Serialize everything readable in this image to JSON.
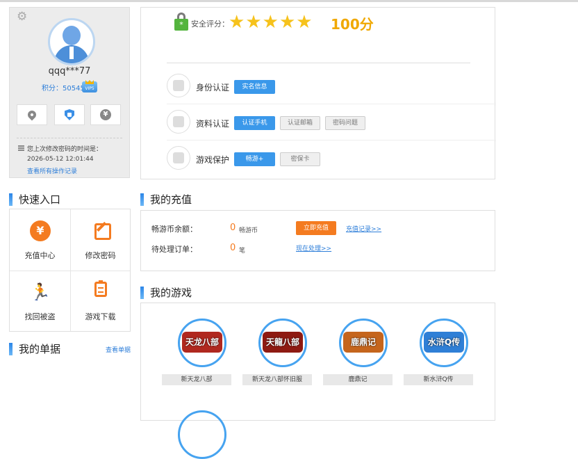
{
  "profile": {
    "username": "qqq***77",
    "points_label": "积分：50545",
    "vip": "VIP5",
    "password_changed_label": "您上次修改密码的时间是：",
    "password_changed_time": "2026-05-12 12:01:44",
    "view_logs_link": "查看所有操作记录"
  },
  "security": {
    "label": "安全评分：",
    "stars": 5,
    "score": "100分",
    "rows": [
      {
        "label": "身份认证",
        "buttons": [
          {
            "text": "实名信息",
            "style": "blue"
          }
        ]
      },
      {
        "label": "资料认证",
        "buttons": [
          {
            "text": "认证手机",
            "style": "blue"
          },
          {
            "text": "认证邮箱",
            "style": "gray"
          },
          {
            "text": "密码问题",
            "style": "gray"
          }
        ]
      },
      {
        "label": "游戏保护",
        "buttons": [
          {
            "text": "畅游+",
            "style": "blue"
          },
          {
            "text": "密保卡",
            "style": "gray"
          }
        ]
      }
    ]
  },
  "quick_entry": {
    "title": "快速入口",
    "items": [
      {
        "label": "充值中心",
        "icon": "yen-circle-icon"
      },
      {
        "label": "修改密码",
        "icon": "edit-icon"
      },
      {
        "label": "找回被盗",
        "icon": "runner-icon"
      },
      {
        "label": "游戏下载",
        "icon": "clipboard-icon"
      }
    ]
  },
  "orders": {
    "title": "我的单据",
    "view_link": "查看单据"
  },
  "recharge": {
    "title": "我的充值",
    "balance_label": "畅游币余额：",
    "balance_value": "0",
    "balance_unit": "畅游币",
    "recharge_button": "立即充值",
    "records_link": "充值记录>>",
    "pending_label": "待处理订单：",
    "pending_value": "0",
    "pending_unit": "笔",
    "process_link": "现在处理>>"
  },
  "games": {
    "title": "我的游戏",
    "items": [
      {
        "name": "新天龙八部",
        "logo": "天龙八部",
        "color": "#b0281f"
      },
      {
        "name": "新天龙八部怀旧服",
        "logo": "天龍八部",
        "color": "#8e1a12"
      },
      {
        "name": "鹿鼎记",
        "logo": "鹿鼎记",
        "color": "#c5651d"
      },
      {
        "name": "新水浒Q传",
        "logo": "水浒Q传",
        "color": "#2f7fd6"
      }
    ]
  },
  "colors": {
    "accent_blue": "#3a98ea",
    "accent_orange": "#f47b20",
    "star": "#f6c21c"
  }
}
